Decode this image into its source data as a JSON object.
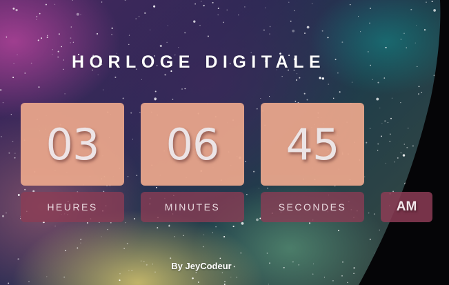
{
  "clock": {
    "title": "HORLOGE DIGITALE",
    "hours": "03",
    "minutes": "06",
    "seconds": "45",
    "hours_label": "HEURES",
    "minutes_label": "MINUTES",
    "seconds_label": "SECONDES",
    "period": "AM"
  },
  "footer": {
    "credit": "By JeyCodeur"
  },
  "colors": {
    "digit_box": "#e8a58b",
    "label_box": "#8c3c55",
    "digit_text": "#f7eeee"
  }
}
